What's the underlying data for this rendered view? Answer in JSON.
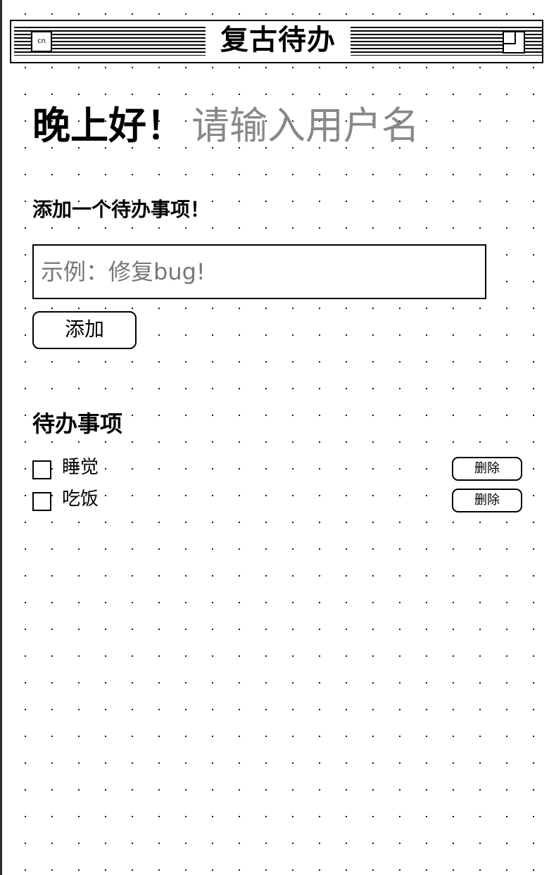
{
  "header": {
    "title": "复古待办",
    "lang_label": "cn",
    "icons": {
      "lang": "language-toggle",
      "zoom": "zoom-box-icon"
    }
  },
  "greeting": {
    "label": "晚上好！",
    "username_placeholder": "请输入用户名"
  },
  "add_form": {
    "heading": "添加一个待办事项！",
    "input_placeholder": "示例：修复bug!",
    "add_label": "添加"
  },
  "todos": {
    "heading": "待办事项",
    "items": [
      {
        "text": "睡觉",
        "done": false,
        "delete_label": "删除"
      },
      {
        "text": "吃饭",
        "done": false,
        "delete_label": "删除"
      }
    ]
  },
  "colors": {
    "background": "#ffffff",
    "foreground": "#000000",
    "placeholder": "#888888",
    "dot_grid": "#000000"
  }
}
